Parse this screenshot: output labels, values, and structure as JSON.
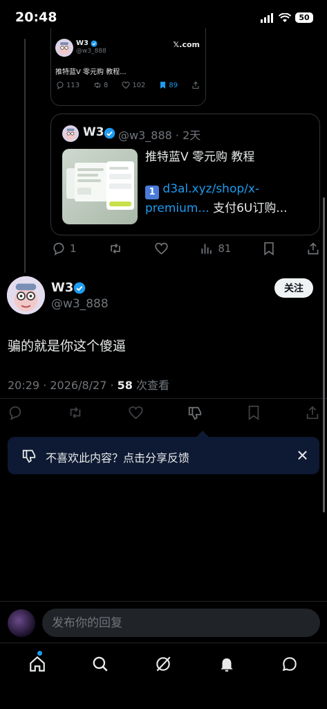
{
  "status_bar": {
    "time": "20:48",
    "battery": "50"
  },
  "embedded_screenshot": {
    "name": "W3",
    "handle": "@w3_888",
    "site": "𝕏.com",
    "text": "推特蓝V 零元购 教程...",
    "replies": "113",
    "retweets": "8",
    "likes": "102",
    "bookmarks": "89"
  },
  "quoted_tweet": {
    "name": "W3",
    "handle_time": "@w3_888 · 2天",
    "title": "推特蓝V 零元购 教程",
    "badge": "1",
    "link": "d3al.xyz/shop/x-premium...",
    "trailing": " 支付6U订购..."
  },
  "quote_actions": {
    "replies": "1",
    "views": "81"
  },
  "main_tweet": {
    "name": "W3",
    "handle": "@w3_888",
    "follow_label": "关注",
    "text": "骗的就是你这个傻逼",
    "meta_prefix": "20:29 · 2026/8/27 · ",
    "views_count": "58",
    "views_suffix": " 次查看"
  },
  "feedback_banner": {
    "text": "不喜欢此内容？点击分享反馈"
  },
  "reply_bar": {
    "placeholder": "发布你的回复"
  },
  "colors": {
    "accent": "#1d9bf0",
    "banner_bg": "#0e1a33",
    "muted": "#71767b"
  },
  "icons": [
    "reply-icon",
    "retweet-icon",
    "like-icon",
    "views-icon",
    "bookmark-icon",
    "share-icon",
    "dislike-icon",
    "close-icon",
    "home-icon",
    "search-icon",
    "grok-icon",
    "bell-icon",
    "message-icon",
    "verified-icon"
  ]
}
